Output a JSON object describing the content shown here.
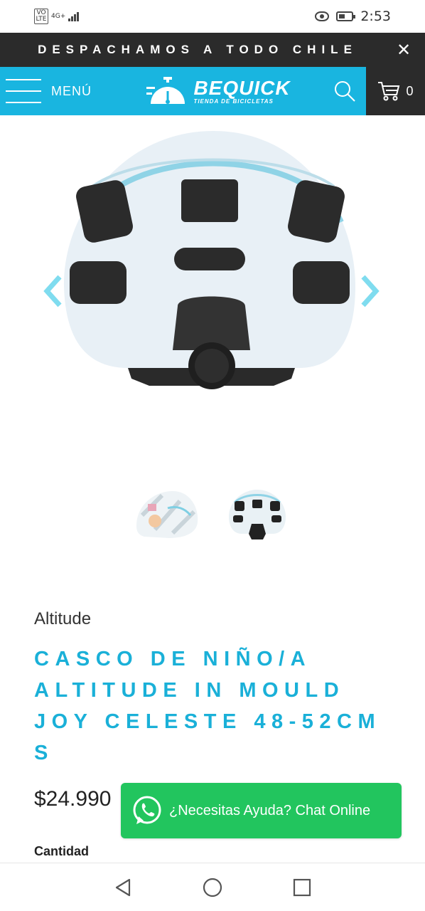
{
  "status_bar": {
    "volte": "VO LTE",
    "network": "4G+",
    "time": "2:53"
  },
  "announcement": {
    "text": "DESPACHAMOS A TODO CHILE",
    "close_icon": "close-icon"
  },
  "header": {
    "menu_label": "MENÚ",
    "logo_name": "BEQUICK",
    "logo_sub": "TIENDA DE BICICLETAS",
    "cart_count": "0",
    "accent_color": "#19b5e0"
  },
  "gallery": {
    "prev_icon": "chevron-left-icon",
    "next_icon": "chevron-right-icon",
    "thumbnails": [
      "thumbnail-helmet-side",
      "thumbnail-helmet-back"
    ]
  },
  "product": {
    "brand": "Altitude",
    "title": "CASCO DE NIÑO/A ALTITUDE IN MOULD JOY CELESTE 48-52CM S",
    "price": "$24.990",
    "quantity_label": "Cantidad",
    "title_color": "#1ab0d8"
  },
  "chat": {
    "label": "¿Necesitas Ayuda? Chat Online",
    "color": "#22c55e"
  }
}
